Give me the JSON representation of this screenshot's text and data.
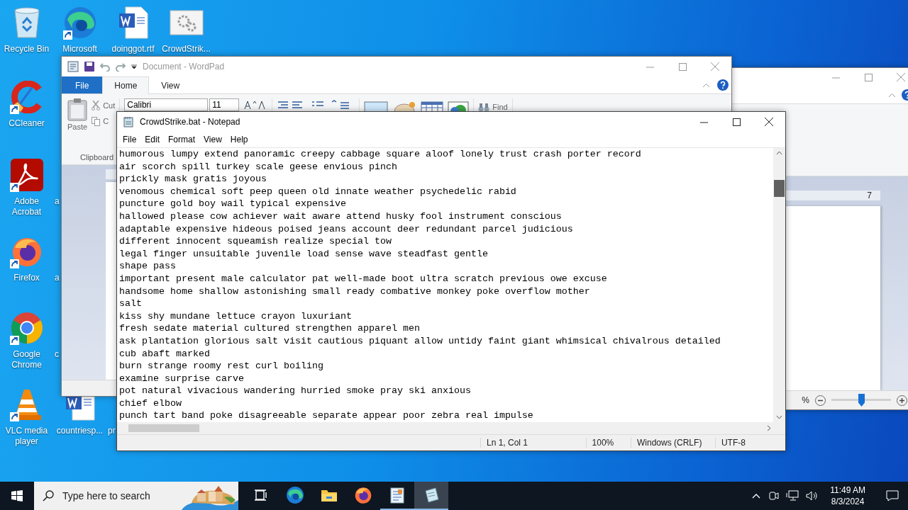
{
  "desktop_icons": [
    {
      "label": "Recycle Bin",
      "kind": "recycle-bin",
      "shortcut": false
    },
    {
      "label": "CCleaner",
      "kind": "ccleaner",
      "shortcut": true
    },
    {
      "label": "Adobe Acrobat",
      "kind": "acrobat",
      "shortcut": true
    },
    {
      "label": "Firefox",
      "kind": "firefox",
      "shortcut": true
    },
    {
      "label": "Google Chrome",
      "kind": "chrome",
      "shortcut": true
    },
    {
      "label": "VLC media player",
      "kind": "vlc",
      "shortcut": true
    },
    {
      "label": "Microsoft",
      "kind": "edge",
      "shortcut": true
    },
    {
      "label": "a",
      "kind": "fragment"
    },
    {
      "label": "a",
      "kind": "fragment"
    },
    {
      "label": "c",
      "kind": "fragment"
    },
    {
      "label": "countriesp...",
      "kind": "word-doc",
      "shortcut": false
    },
    {
      "label": "doinggot.rtf",
      "kind": "word-doc",
      "shortcut": false
    },
    {
      "label": "pr",
      "kind": "fragment"
    },
    {
      "label": "CrowdStrik...",
      "kind": "bat-file",
      "shortcut": false
    }
  ],
  "back_window": {
    "ruler_number": "7",
    "zoom": {
      "reading": "%",
      "level": 0.5
    }
  },
  "wordpad": {
    "title": "Document - WordPad",
    "tabs": [
      {
        "label": "File",
        "kind": "file",
        "selected": false
      },
      {
        "label": "Home",
        "kind": "tab",
        "selected": true
      },
      {
        "label": "View",
        "kind": "tab",
        "selected": false
      }
    ],
    "ribbon": {
      "paste": "Paste",
      "cut": "Cut",
      "copy": "C",
      "font": "Calibri",
      "size": "11",
      "find": "Find",
      "group": "Clipboard"
    }
  },
  "notepad": {
    "title": "CrowdStrike.bat - Notepad",
    "menu": [
      "File",
      "Edit",
      "Format",
      "View",
      "Help"
    ],
    "lines": [
      "humorous lumpy extend panoramic creepy cabbage square aloof lonely trust crash porter record",
      "air scorch spill turkey scale geese envious pinch",
      "prickly mask gratis joyous",
      "venomous chemical soft peep queen old innate weather psychedelic rabid",
      "puncture gold boy wail typical expensive",
      "hallowed please cow achiever wait aware attend husky fool instrument conscious",
      "adaptable expensive hideous poised jeans account deer redundant parcel judicious",
      "different innocent squeamish realize special tow",
      "legal finger unsuitable juvenile load sense wave steadfast gentle",
      "shape pass",
      "important present male calculator pat well-made boot ultra scratch previous owe excuse",
      "handsome home shallow astonishing small ready combative monkey poke overflow mother",
      "salt",
      "kiss shy mundane lettuce crayon luxuriant",
      "fresh sedate material cultured strengthen apparel men",
      "ask plantation glorious salt visit cautious piquant allow untidy faint giant whimsical chivalrous detailed",
      "cub abaft marked",
      "burn strange roomy rest curl boiling",
      "examine surprise carve",
      "pot natural vivacious wandering hurried smoke pray ski anxious",
      "chief elbow",
      "punch tart band poke disagreeable separate appear poor zebra real impulse"
    ],
    "status": [
      "Ln 1, Col 1",
      "100%",
      "Windows (CRLF)",
      "UTF-8"
    ]
  },
  "taskbar": {
    "search_placeholder": "Type here to search",
    "apps": [
      {
        "kind": "task-view",
        "running": false,
        "selected": false
      },
      {
        "kind": "edge",
        "running": false,
        "selected": false
      },
      {
        "kind": "explorer",
        "running": false,
        "selected": false
      },
      {
        "kind": "firefox",
        "running": false,
        "selected": false
      },
      {
        "kind": "wordpad",
        "running": true,
        "selected": false
      },
      {
        "kind": "notepad",
        "running": true,
        "selected": true
      }
    ],
    "time": "11:49 AM",
    "date": "8/3/2024"
  }
}
